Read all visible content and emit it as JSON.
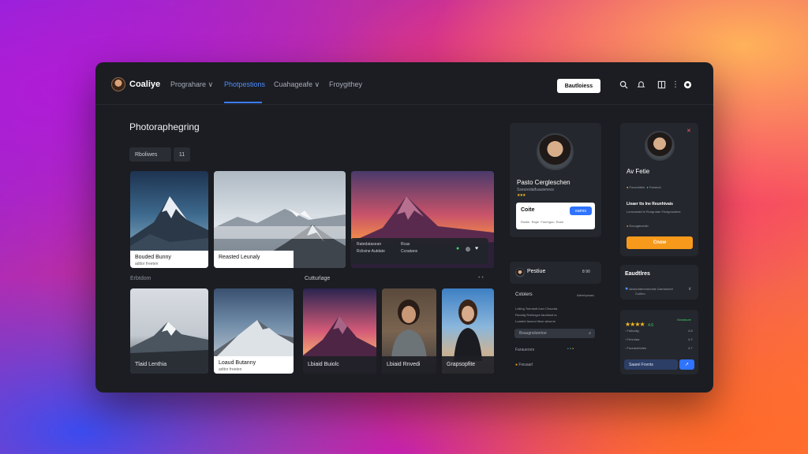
{
  "app": {
    "brand": "Coaliye",
    "nav": [
      {
        "label": "Prograhare ∨"
      },
      {
        "label": "Photpestions"
      },
      {
        "label": "Cuahageafe ∨"
      },
      {
        "label": "Froygithey"
      }
    ],
    "cta_label": "Bautloiess",
    "icons": [
      "search-icon",
      "bell-icon",
      "layout-icon",
      "more-vertical-icon",
      "profile-dot-icon"
    ]
  },
  "main": {
    "title": "Photoraphegring",
    "filters": [
      "Rboliwes",
      "11"
    ],
    "row1_cards": [
      {
        "title": "Bouded Bunny",
        "sub": "aditor freeten"
      },
      {
        "title": "Reasted Leunaly",
        "sub": ""
      },
      {
        "title": "",
        "sub": ""
      }
    ],
    "overlay": {
      "col1": [
        "Ratedatasean",
        "Rclisine Autdate"
      ],
      "col2": [
        "Rcas",
        "Ccoatans"
      ]
    },
    "section_left": "Erbtdom",
    "section_mid": "Cutturlage",
    "row2_cards": [
      {
        "title": "Tlaid Lenthia"
      },
      {
        "title": "Loaud Butanny",
        "sub": "aditor freeten"
      },
      {
        "title": "Lbiaid Buiolc"
      },
      {
        "title": "Lbiaid Rnvedi"
      },
      {
        "title": "Grapsopfite"
      }
    ]
  },
  "profile_card": {
    "name": "Pasto Cergleschen",
    "subtitle": "Sseuredatfuauieness",
    "field_label": "Coite",
    "button": "eamrs",
    "meta": [
      "Rostie",
      "Rape",
      "Fouregou",
      "Ruse"
    ]
  },
  "mini_profile": {
    "name": "Pestiue",
    "count": "8 90",
    "section": "Cxlolers",
    "section_right": "Atemhpsraa",
    "lines": [
      "Lotiing Tonraedt iusn Chourda",
      "Recsitg Rcilinsgrs faudiand ia",
      "Loaded fanoud Ithan alvurne"
    ],
    "search_placeholder": "Bsaugnsloertoe",
    "row_label": "Farauersrs",
    "footer": "Fwuaarl"
  },
  "right_profile": {
    "name": "Av Fetie",
    "meta": [
      "Foucnhtels",
      "Farutcot"
    ],
    "heading": "Lleaer tts Ine Reunhivais",
    "desc": "Lomcueaid le Rcngrutan Fectgnuolees",
    "link": "Eecogtecriclb",
    "button": "Cnow"
  },
  "reviews": {
    "title": "Eaudtlres",
    "item": "Aeolurbtemnrmnels Gamtonnet",
    "tag": "Co0leo"
  },
  "ratings": {
    "stars": 4,
    "score": "4.6",
    "label": "Sceatsure",
    "items": [
      {
        "label": "Faltuolig",
        "value": "4.8"
      },
      {
        "label": "Fenrulaa",
        "value": "4.2"
      },
      {
        "label": "Fouracertoles",
        "value": "4.7"
      }
    ],
    "input_value": "Saarel Fovnts"
  },
  "colors": {
    "accent": "#2f73ff",
    "orange": "#f79a1c",
    "window_bg": "#1b1d22"
  }
}
